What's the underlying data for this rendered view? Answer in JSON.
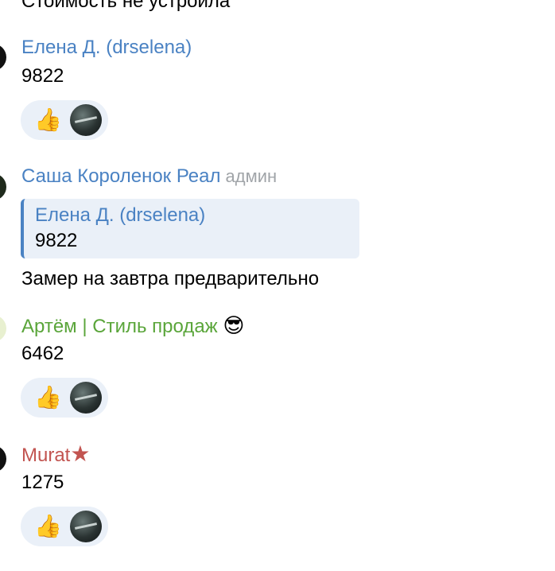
{
  "previous_message": {
    "text": "Стоимость не устроила"
  },
  "messages": [
    {
      "sender": "Елена Д. (drselena)",
      "text": "9822",
      "reaction": {
        "emoji": "👍",
        "icon": "thumbs-up-icon"
      }
    },
    {
      "sender": "Саша Короленок Реал",
      "role": "админ",
      "reply": {
        "sender": "Елена Д. (drselena)",
        "text": "9822"
      },
      "text": "Замер на завтра предварительно"
    },
    {
      "sender": "Артём | Стиль продаж",
      "sender_emoji": "😎",
      "text": "6462",
      "reaction": {
        "emoji": "👍",
        "icon": "thumbs-up-icon"
      }
    },
    {
      "sender": "Murat",
      "sender_badge": "★",
      "text": "1275",
      "reaction": {
        "emoji": "👍",
        "icon": "thumbs-up-icon"
      }
    }
  ],
  "colors": {
    "sender_blue": "#4a82c3",
    "sender_green": "#5aa53a",
    "sender_red": "#c25450",
    "reaction_bg": "#eaf0f8",
    "role_gray": "#a0a4a8"
  }
}
